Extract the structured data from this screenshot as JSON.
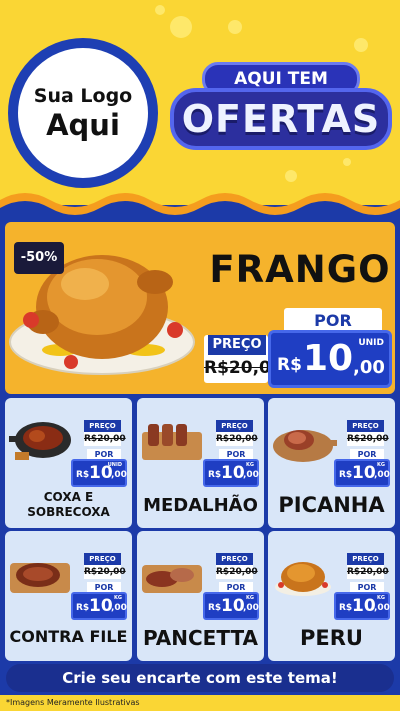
{
  "logo": {
    "line1": "Sua Logo",
    "line2": "Aqui"
  },
  "badge": {
    "top": "AQUI TEM",
    "main": "OFERTAS"
  },
  "hero": {
    "discount": "-50%",
    "title": "FRANGO",
    "preco_label": "PREÇO",
    "old_price": "R$20,00",
    "por_label": "POR",
    "currency": "R$",
    "price_int": "10",
    "price_dec": ",00",
    "unit": "UNID"
  },
  "products": [
    {
      "name": "COXA E SOBRECOXA",
      "preco_label": "PREÇO",
      "old_price": "R$20,00",
      "por_label": "POR",
      "currency": "R$",
      "price_int": "10",
      "price_dec": ",00",
      "unit": "UNID",
      "icon": "chicken-thigh-pan-icon"
    },
    {
      "name": "MEDALHÃO",
      "preco_label": "PREÇO",
      "old_price": "R$20,00",
      "por_label": "POR",
      "currency": "R$",
      "price_int": "10",
      "price_dec": ",00",
      "unit": "KG",
      "icon": "medallion-skewers-icon"
    },
    {
      "name": "PICANHA",
      "preco_label": "PREÇO",
      "old_price": "R$20,00",
      "por_label": "POR",
      "currency": "R$",
      "price_int": "10",
      "price_dec": ",00",
      "unit": "KG",
      "icon": "picanha-board-icon"
    },
    {
      "name": "CONTRA FILE",
      "preco_label": "PREÇO",
      "old_price": "R$20,00",
      "por_label": "POR",
      "currency": "R$",
      "price_int": "10",
      "price_dec": ",00",
      "unit": "KG",
      "icon": "steak-board-icon"
    },
    {
      "name": "PANCETTA",
      "preco_label": "PREÇO",
      "old_price": "R$20,00",
      "por_label": "POR",
      "currency": "R$",
      "price_int": "10",
      "price_dec": ",00",
      "unit": "KG",
      "icon": "pancetta-board-icon"
    },
    {
      "name": "PERU",
      "preco_label": "PREÇO",
      "old_price": "R$20,00",
      "por_label": "POR",
      "currency": "R$",
      "price_int": "10",
      "price_dec": ",00",
      "unit": "KG",
      "icon": "roast-turkey-icon"
    }
  ],
  "cta": "Crie seu encarte com este tema!",
  "footnote": "*Imagens Meramente Ilustrativas",
  "colors": {
    "yellow": "#fad634",
    "blue": "#1c3aa8",
    "orange": "#f5b32c",
    "card": "#d9e6f8"
  }
}
